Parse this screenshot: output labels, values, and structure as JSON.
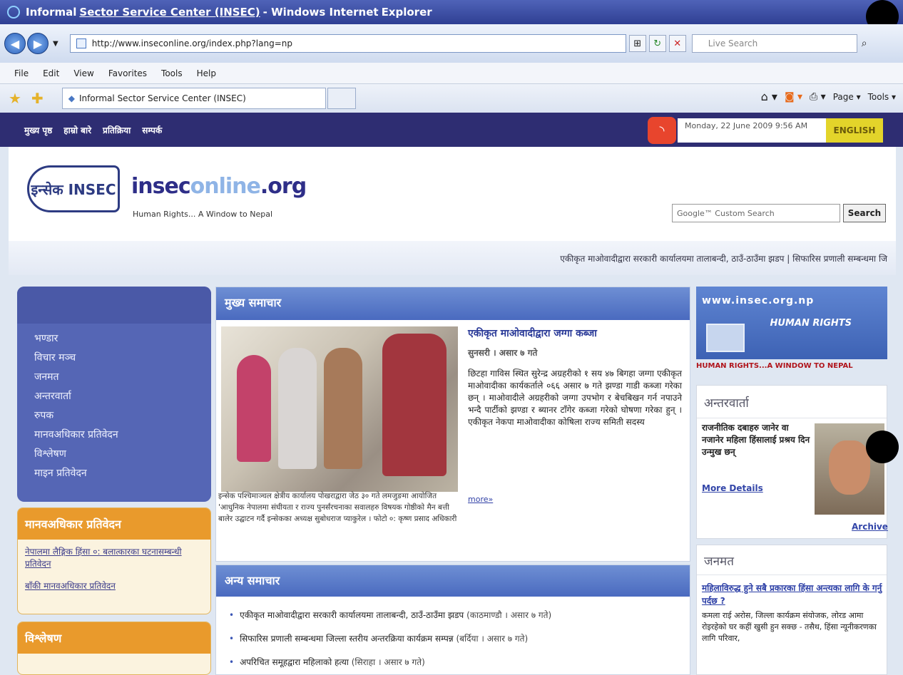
{
  "window": {
    "title_part1": "Informal ",
    "title_part2": "Sector Service Center (INSEC)",
    "title_part3": " - Windows Internet ",
    "title_part4": "Explorer"
  },
  "address": {
    "url": "http://www.inseconline.org/index.php?lang=np",
    "search_placeholder": "Live Search"
  },
  "menu": [
    "File",
    "Edit",
    "View",
    "Favorites",
    "Tools",
    "Help"
  ],
  "tab": {
    "label": "Informal Sector Service Center (INSEC)"
  },
  "commandbar": {
    "page": "Page ▾",
    "tools": "Tools ▾"
  },
  "sitenav": [
    "मुख्य पृष्ठ",
    "हाम्रो बारे",
    "प्रतिक्रिया",
    "सम्पर्क"
  ],
  "date": "Monday, 22 June 2009 9:56 AM",
  "language": "ENGLISH",
  "brand": {
    "logo": "इन्सेक INSEC",
    "name_a": "insec",
    "name_b": "online",
    "name_c": ".org",
    "tagline": "Human Rights... A Window to Nepal"
  },
  "search": {
    "placeholder": "Google™ Custom Search",
    "button": "Search"
  },
  "ticker": "एकीकृत माओवादीद्वारा सरकारी कार्यालयमा तालाबन्दी, ठाउँ-ठाउँमा झडप | सिफारिस प्रणाली सम्बन्धमा जि",
  "leftnav": [
    "भण्डार",
    "विचार मञ्च",
    "जनमत",
    "अन्तरवार्ता",
    "रुपक",
    "मानवअधिकार प्रतिवेदन",
    "विश्लेषण",
    "माइन प्रतिवेदन"
  ],
  "hr_report": {
    "title": "मानवअधिकार प्रतिवेदन",
    "item": "नेपालमा लैङ्गिक हिंसा ०: बलात्कारका घटनासम्बन्धी प्रतिवेदन",
    "link": "बाँकी मानवअधिकार प्रतिवेदन"
  },
  "analysis": {
    "title": "विश्लेषण"
  },
  "main_news": {
    "heading": "मुख्य समाचार",
    "title": "एकीकृत माओवादीद्वारा जग्गा कब्जा",
    "dateline": "सुनसरी । असार ७ गते",
    "body": "छिटहा गाविस स्थित सुरेन्द्र अग्रहरीको १ सय ४७ बिगहा जग्गा एकीकृत माओवादीका कार्यकर्ताले ०६६ असार ७ गते झण्डा गाडी कब्जा गरेका छन् । माओवादीले अग्रहरीको जग्गा उपभोग र बेचबिखन गर्न नपाउने भन्दै पार्टीको झण्डा र ब्यानर टाँगेर कब्जा गरेको घोषणा गरेका हुन् । एकीकृत नेकपा माओवादीका कोषिला राज्य समिती सदस्य",
    "more": "more»",
    "caption": "इन्सेक पश्चिमाञ्चल क्षेत्रीय कार्यालय पोखराद्वारा जेठ ३० गते लमजुङमा आयोजित 'आधुनिक नेपालमा संघीयता र राज्य पुनर्संरचनाका सवालहरु विषयक गोष्ठीको मैन बत्ती बालेर उद्घाटन गर्दै इन्सेकका अध्यक्ष सुबोधराज प्याकुरेल । फोटो ०: कृष्ण प्रसाद अधिकारी"
  },
  "other_news": {
    "heading": "अन्य समाचार",
    "items": [
      {
        "text": "एकीकृत माओवादीद्वारा सरकारी कार्यालयमा तालाबन्दी, ठाउँ-ठाउँमा झडप",
        "date": "(काठमाण्डौ । असार ७ गते)"
      },
      {
        "text": "सिफारिस प्रणाली सम्बन्धमा जिल्ला स्तरीय अन्तरक्रिया कार्यक्रम सम्पन्न",
        "date": "(बर्दिया । असार ७ गते)"
      },
      {
        "text": "अपरिचित समूहद्वारा महिलाको हत्या",
        "date": "(सिराहा । असार ७ गते)"
      }
    ]
  },
  "right": {
    "banner_url": "www.insec.org.np",
    "banner_tag": "HUMAN RIGHTS",
    "banner_foot": "HUMAN RIGHTS...A WINDOW TO NEPAL",
    "interview_title": "अन्तरवार्ता",
    "interview_text": "राजनीतिक दबाहरु जानेर वा नजानेर महिला हिंसालाई प्रश्रय दिन उन्मुख छन्",
    "interview_link": "More Details",
    "archive": "Archive",
    "poll_title": "जनमत",
    "poll_question": "महिलाविरुद्ध हुने सबै प्रकारका हिंसा अन्त्यका लागि के गर्नु पर्दछ ?",
    "poll_answer": "कमला राई अरोस, जिल्ला कार्यक्रम संयोजक, लोरड आमा रोइरहेको घर कहीं खुसी हुन सक्छ - तसैथ, हिंसा न्यूनीकरणका लागि परिवार,"
  }
}
